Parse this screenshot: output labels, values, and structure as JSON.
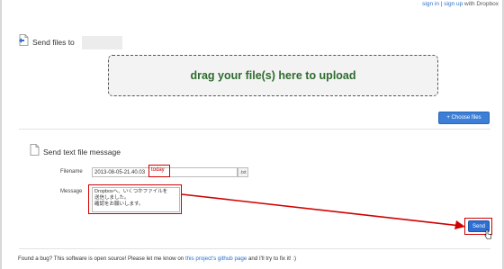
{
  "topbar": {
    "sign_in": "sign in",
    "sep": " | ",
    "sign_up": "sign up",
    "with": " with Dropbox"
  },
  "send_files": {
    "title": "Send files to"
  },
  "dropzone": {
    "text": "drag your file(s) here to upload"
  },
  "choose_button": {
    "label": "+ Choose files"
  },
  "message_section": {
    "title": "Send text file message"
  },
  "form": {
    "filename_label": "Filename",
    "filename_value": "2013-08-05-21.40.03",
    "filename_suffix": "today",
    "extension": ".txt",
    "message_label": "Message",
    "message_value": "Dropboxへ、いくつかファイルを\n送信しました。\n確認をお願いします。"
  },
  "send_button": {
    "label": "Send"
  },
  "footer": {
    "prefix": "Found a bug? This software is open source! Please let me know on ",
    "link": "this project's github page",
    "suffix": " and I'll try to fix it! :)"
  },
  "colors": {
    "highlight": "#d10000",
    "primary_button": "#2f6fd1",
    "dropzone_text": "#2e6b2e",
    "link": "#2a6fc9"
  }
}
